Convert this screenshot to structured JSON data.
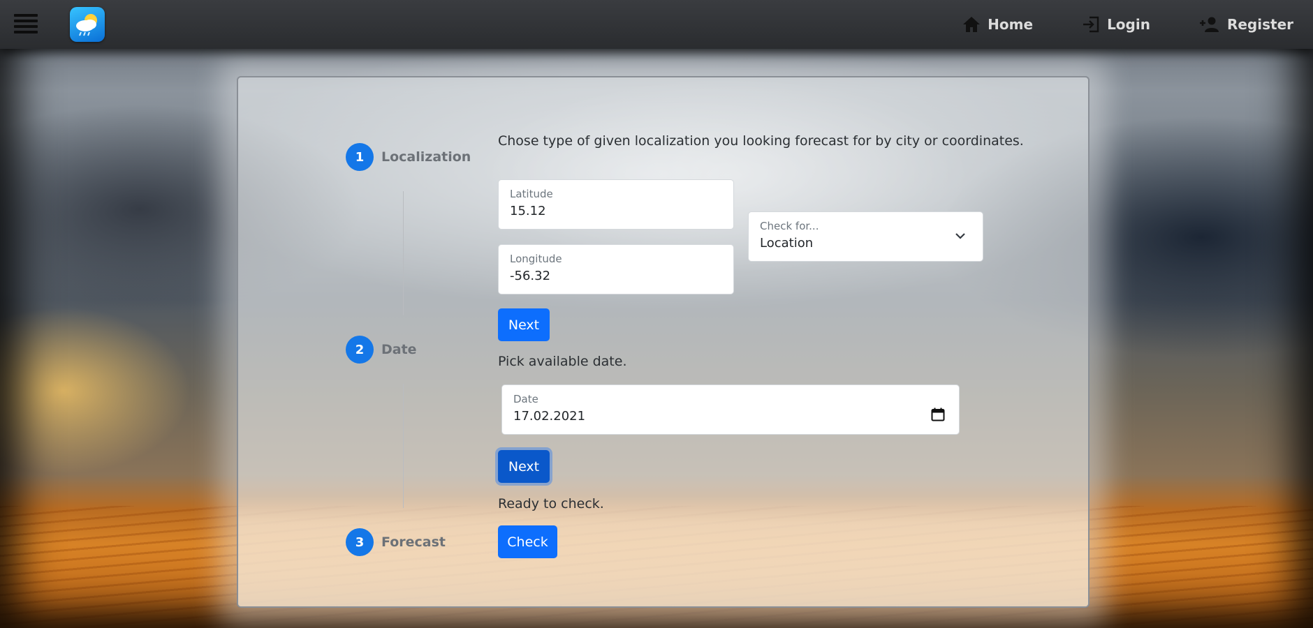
{
  "nav": {
    "menu_icon": "hamburger-menu-icon",
    "logo_icon": "weather-cloud-sun-rain-icon",
    "links": [
      {
        "label": "Home",
        "icon": "home-icon"
      },
      {
        "label": "Login",
        "icon": "login-icon"
      },
      {
        "label": "Register",
        "icon": "add-user-icon"
      }
    ]
  },
  "stepper": {
    "steps": [
      {
        "number": "1",
        "label": "Localization"
      },
      {
        "number": "2",
        "label": "Date"
      },
      {
        "number": "3",
        "label": "Forecast"
      }
    ]
  },
  "localization": {
    "description": "Chose type of given localization you looking forecast for by city or coordinates.",
    "latitude": {
      "label": "Latitude",
      "value": "15.12"
    },
    "longitude": {
      "label": "Longitude",
      "value": "-56.32"
    },
    "check_for": {
      "label": "Check for...",
      "selected": "Location"
    },
    "next_label": "Next"
  },
  "date": {
    "description": "Pick available date.",
    "field": {
      "label": "Date",
      "value": "17.02.2021"
    },
    "next_label": "Next"
  },
  "forecast": {
    "description": "Ready to check.",
    "check_label": "Check"
  },
  "colors": {
    "primary": "#0d6efd",
    "step_circle": "#1477e8",
    "navbar": "#2f3134"
  }
}
